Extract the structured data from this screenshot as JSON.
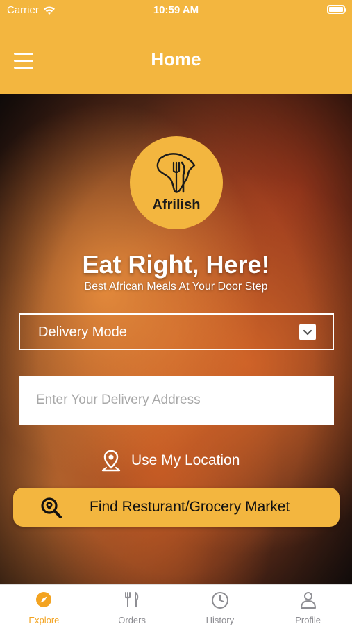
{
  "status_bar": {
    "carrier": "Carrier",
    "time": "10:59 AM"
  },
  "header": {
    "title": "Home",
    "menu_icon": "hamburger-menu-icon"
  },
  "brand": {
    "logo_text": "Afrilish"
  },
  "hero": {
    "headline": "Eat Right, Here!",
    "subline": "Best African Meals At Your Door Step"
  },
  "delivery_mode": {
    "selected": "Delivery Mode"
  },
  "address": {
    "placeholder": "Enter Your Delivery Address",
    "value": ""
  },
  "use_location": {
    "label": "Use My Location"
  },
  "find_button": {
    "label": "Find Resturant/Grocery Market"
  },
  "tabs": [
    {
      "label": "Explore",
      "icon": "compass-icon",
      "active": true
    },
    {
      "label": "Orders",
      "icon": "cutlery-icon",
      "active": false
    },
    {
      "label": "History",
      "icon": "clock-icon",
      "active": false
    },
    {
      "label": "Profile",
      "icon": "person-icon",
      "active": false
    }
  ],
  "colors": {
    "accent": "#f3b63f",
    "active_tab": "#f3a320",
    "inactive_tab": "#8e8e93"
  }
}
